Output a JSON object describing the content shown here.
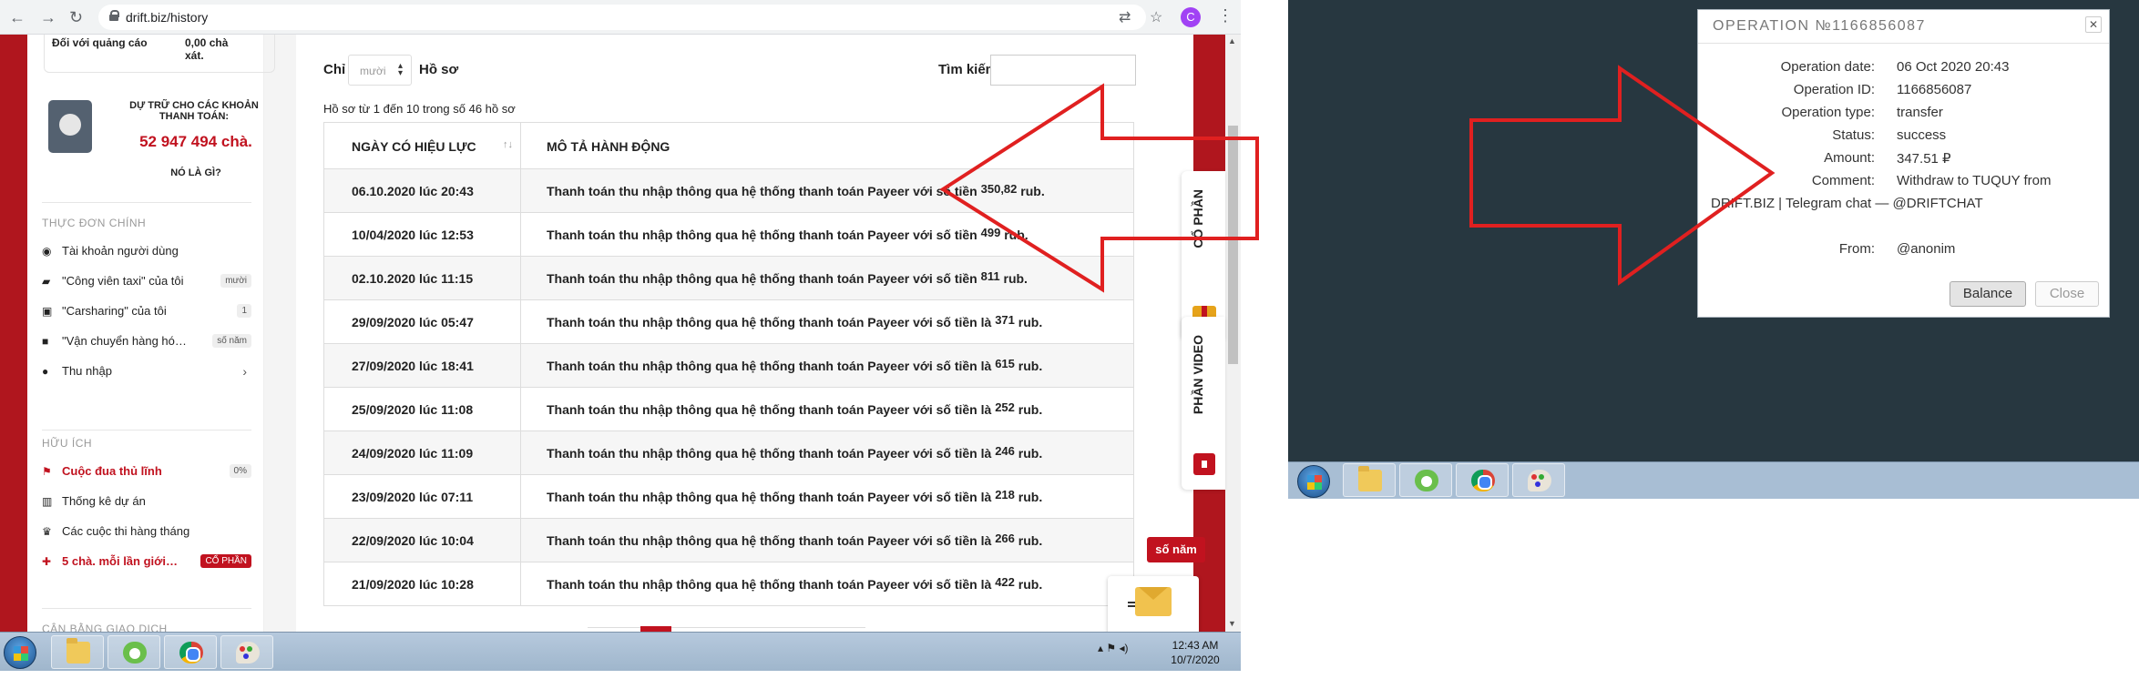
{
  "browser": {
    "url": "drift.biz/history",
    "profile_initial": "C"
  },
  "sidebar": {
    "ad_text_left": "Đối với quảng cáo",
    "ad_value": "0,00 chà xát.",
    "reserve_title": "DỰ TRỮ CHO CÁC KHOẢN THANH TOÁN:",
    "reserve_value": "52 947 494 chà.",
    "reserve_link": "NÓ LÀ GÌ?",
    "main_menu_title": "THỰC ĐƠN CHÍNH",
    "main_menu": [
      {
        "label": "Tài khoản người dùng",
        "badge": ""
      },
      {
        "label": "\"Công viên taxi\" của tôi",
        "badge": "mười"
      },
      {
        "label": "\"Carsharing\" của tôi",
        "badge": "1"
      },
      {
        "label": "\"Vận chuyển hàng hó…",
        "badge": "số năm"
      },
      {
        "label": "Thu nhập",
        "badge": "›"
      }
    ],
    "useful_title": "HỮU ÍCH",
    "useful_menu": [
      {
        "label": "Cuộc đua thủ lĩnh",
        "badge": "0%"
      },
      {
        "label": "Thống kê dự án",
        "badge": ""
      },
      {
        "label": "Các cuộc thi hàng tháng",
        "badge": ""
      },
      {
        "label": "5 chà. mỗi lần giới…",
        "badge": "CỔ PHẦN"
      }
    ],
    "bottom_section_title": "CÂN BẰNG GIAO DỊCH"
  },
  "history": {
    "length_label": "Chỉ",
    "length_value": "mười",
    "records_label": "Hồ sơ",
    "search_label": "Tìm kiếm:",
    "info": "Hồ sơ từ 1 đến 10 trong số 46 hồ sơ",
    "col_date": "NGÀY CÓ HIỆU LỰC",
    "col_desc": "MÔ TẢ HÀNH ĐỘNG",
    "rows": [
      {
        "date": "06.10.2020 lúc 20:43",
        "text": "Thanh toán thu nhập thông qua hệ thống thanh toán Payeer với số tiền",
        "amount": "350,82",
        "unit": "rub."
      },
      {
        "date": "10/04/2020 lúc 12:53",
        "text": "Thanh toán thu nhập thông qua hệ thống thanh toán Payeer với số tiền",
        "amount": "499",
        "unit": "rub."
      },
      {
        "date": "02.10.2020 lúc 11:15",
        "text": "Thanh toán thu nhập thông qua hệ thống thanh toán Payeer với số tiền",
        "amount": "811",
        "unit": "rub."
      },
      {
        "date": "29/09/2020 lúc 05:47",
        "text": "Thanh toán thu nhập thông qua hệ thống thanh toán Payeer với số tiền là",
        "amount": "371",
        "unit": "rub."
      },
      {
        "date": "27/09/2020 lúc 18:41",
        "text": "Thanh toán thu nhập thông qua hệ thống thanh toán Payeer với số tiền là",
        "amount": "615",
        "unit": "rub."
      },
      {
        "date": "25/09/2020 lúc 11:08",
        "text": "Thanh toán thu nhập thông qua hệ thống thanh toán Payeer với số tiền là",
        "amount": "252",
        "unit": "rub."
      },
      {
        "date": "24/09/2020 lúc 11:09",
        "text": "Thanh toán thu nhập thông qua hệ thống thanh toán Payeer với số tiền là",
        "amount": "246",
        "unit": "rub."
      },
      {
        "date": "23/09/2020 lúc 07:11",
        "text": "Thanh toán thu nhập thông qua hệ thống thanh toán Payeer với số tiền là",
        "amount": "218",
        "unit": "rub."
      },
      {
        "date": "22/09/2020 lúc 10:04",
        "text": "Thanh toán thu nhập thông qua hệ thống thanh toán Payeer với số tiền là",
        "amount": "266",
        "unit": "rub."
      },
      {
        "date": "21/09/2020 lúc 10:28",
        "text": "Thanh toán thu nhập thông qua hệ thống thanh toán Payeer với số tiền là",
        "amount": "422",
        "unit": "rub."
      }
    ]
  },
  "side_tabs": {
    "shares": "CỔ PHẦN",
    "video": "PHẦN VIDEO"
  },
  "chat": {
    "badge": "số năm"
  },
  "taskbar": {
    "time": "12:43 AM",
    "date": "10/7/2020"
  },
  "dialog": {
    "title": "OPERATION №1166856087",
    "fields": [
      {
        "label": "Operation date:",
        "value": "06 Oct 2020 20:43"
      },
      {
        "label": "Operation ID:",
        "value": "1166856087"
      },
      {
        "label": "Operation type:",
        "value": "transfer"
      },
      {
        "label": "Status:",
        "value": "success"
      },
      {
        "label": "Amount:",
        "value": "347.51 ₽"
      },
      {
        "label": "Comment:",
        "value": "Withdraw to TUQUY from"
      }
    ],
    "comment_line2": "DRIFT.BIZ | Telegram chat — @DRIFTCHAT",
    "from_label": "From:",
    "from_value": "@anonim",
    "balance_button": "Balance",
    "close_button": "Close"
  },
  "colors": {
    "brand_red": "#c1121f",
    "desktop_bg": "#273740",
    "arrow_red": "#e02020"
  }
}
